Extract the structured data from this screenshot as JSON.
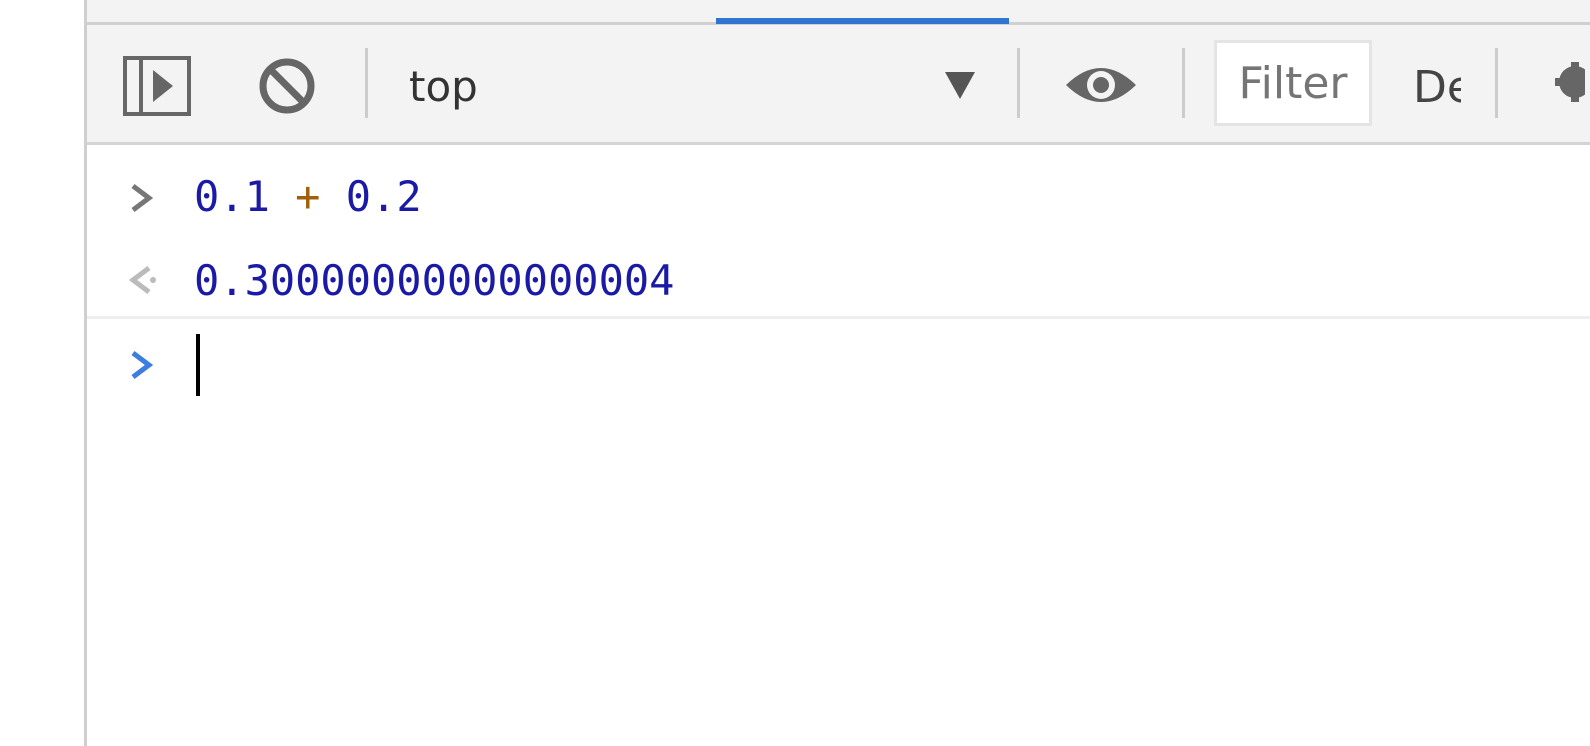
{
  "devtools": {
    "active_tab_indicator_color": "#2f74d0",
    "toolbar": {
      "sidebar_toggle_icon": "sidebar-toggle-icon",
      "clear_console_icon": "clear-console-icon",
      "context_selector": {
        "value": "top",
        "icon": "dropdown-arrow-icon"
      },
      "live_expression_icon": "eye-icon",
      "filter": {
        "placeholder": "Filter",
        "value": ""
      },
      "log_levels_label": "De",
      "settings_icon": "gear-icon"
    },
    "console": {
      "entries": [
        {
          "type": "input",
          "prompt_icon": "chevron-right-icon",
          "left": "0.1",
          "operator": "+",
          "right": "0.2"
        },
        {
          "type": "result",
          "prompt_icon": "return-arrow-icon",
          "value": "0.30000000000000004"
        }
      ],
      "prompt": {
        "prompt_icon": "chevron-right-icon",
        "value": ""
      }
    },
    "colors": {
      "number": "#1a1aa6",
      "operator": "#a0600a",
      "active_prompt": "#3b7de0"
    }
  }
}
